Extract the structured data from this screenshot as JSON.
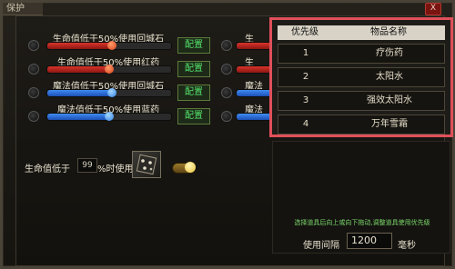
{
  "window": {
    "title": "保护",
    "close_label": "X"
  },
  "rules": [
    {
      "label": "生命值低于50%使用回城石",
      "type": "hp",
      "level": 0.52,
      "config_label": "配置"
    },
    {
      "label": "生命值低于50%使用红药",
      "type": "hp",
      "level": 0.5,
      "config_label": "配置"
    },
    {
      "label": "魔法值低于50%使用回城石",
      "type": "mp",
      "level": 0.52,
      "config_label": "配置"
    },
    {
      "label": "魔法值低于50%使用蓝药",
      "type": "mp",
      "level": 0.5,
      "config_label": "配置"
    }
  ],
  "ghost_rules": [
    {
      "label": "生",
      "type": "hp"
    },
    {
      "label": "生",
      "type": "hp"
    },
    {
      "label": "魔法",
      "type": "mp"
    },
    {
      "label": "魔法",
      "type": "mp"
    }
  ],
  "hp_threshold": {
    "prefix": "生命值低于",
    "value": "99",
    "suffix": "%时使用"
  },
  "priority_table": {
    "headers": [
      "优先级",
      "物品名称"
    ],
    "rows": [
      {
        "priority": "1",
        "name": "疗伤药"
      },
      {
        "priority": "2",
        "name": "太阳水"
      },
      {
        "priority": "3",
        "name": "强效太阳水"
      },
      {
        "priority": "4",
        "name": "万年雪霜"
      }
    ]
  },
  "hint": "选择道具后向上或向下拖动,调整道具使用优先级",
  "interval": {
    "label": "使用间隔",
    "value": "1200",
    "unit": "毫秒"
  },
  "colors": {
    "hp": "#c8281f",
    "mp": "#2f6fe0",
    "accent_green": "#54e36a",
    "overlay_border": "#e0505a"
  }
}
